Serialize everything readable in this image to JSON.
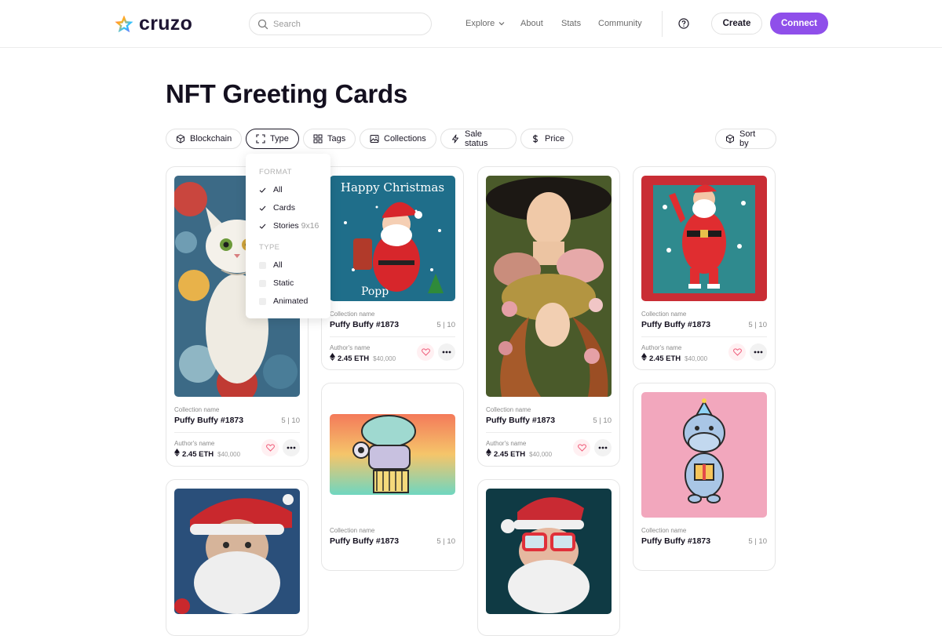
{
  "header": {
    "logo_text": "cruzo",
    "search_placeholder": "Search",
    "nav": {
      "explore": "Explore",
      "about": "About",
      "stats": "Stats",
      "community": "Community"
    },
    "create_label": "Create",
    "connect_label": "Connect"
  },
  "page": {
    "title": "NFT Greeting Cards"
  },
  "filters": {
    "blockchain": "Blockchain",
    "type": "Type",
    "tags": "Tags",
    "collections": "Collections",
    "sale_status": "Sale status",
    "price": "Price",
    "sort_by": "Sort by"
  },
  "type_dropdown": {
    "format_heading": "FORMAT",
    "format_all": "All",
    "format_cards": "Cards",
    "format_stories": "Stories",
    "format_stories_size": "9x16",
    "type_heading": "TYPE",
    "type_all": "All",
    "type_static": "Static",
    "type_animated": "Animated"
  },
  "cards": [
    {
      "collection": "Collection name",
      "name": "Puffy Buffy #1873",
      "edition": "5 | 10",
      "author": "Author's name",
      "price": "2.45 ETH",
      "usd": "$40,000"
    },
    {
      "collection": "Collection name",
      "name": "Puffy Buffy #1873",
      "edition": "5 | 10",
      "author": "Author's name",
      "price": "2.45 ETH",
      "usd": "$40,000",
      "art_text": "Happy Christmas",
      "art_sub": "Popp"
    },
    {
      "collection": "Collection name",
      "name": "Puffy Buffy #1873",
      "edition": "5 | 10",
      "author": "Author's name",
      "price": "2.45 ETH",
      "usd": "$40,000"
    },
    {
      "collection": "Collection name",
      "name": "Puffy Buffy #1873",
      "edition": "5 | 10",
      "author": "Author's name",
      "price": "2.45 ETH",
      "usd": "$40,000"
    },
    {
      "collection": "Collection name",
      "name": "Puffy Buffy #1873",
      "edition": "5 | 10"
    },
    {
      "collection": "Collection name",
      "name": "Puffy Buffy #1873",
      "edition": "5 | 10"
    }
  ],
  "colors": {
    "accent": "#8f4fea",
    "text": "#14101f",
    "muted": "#8a8a8a",
    "border": "#e6e6e6"
  }
}
